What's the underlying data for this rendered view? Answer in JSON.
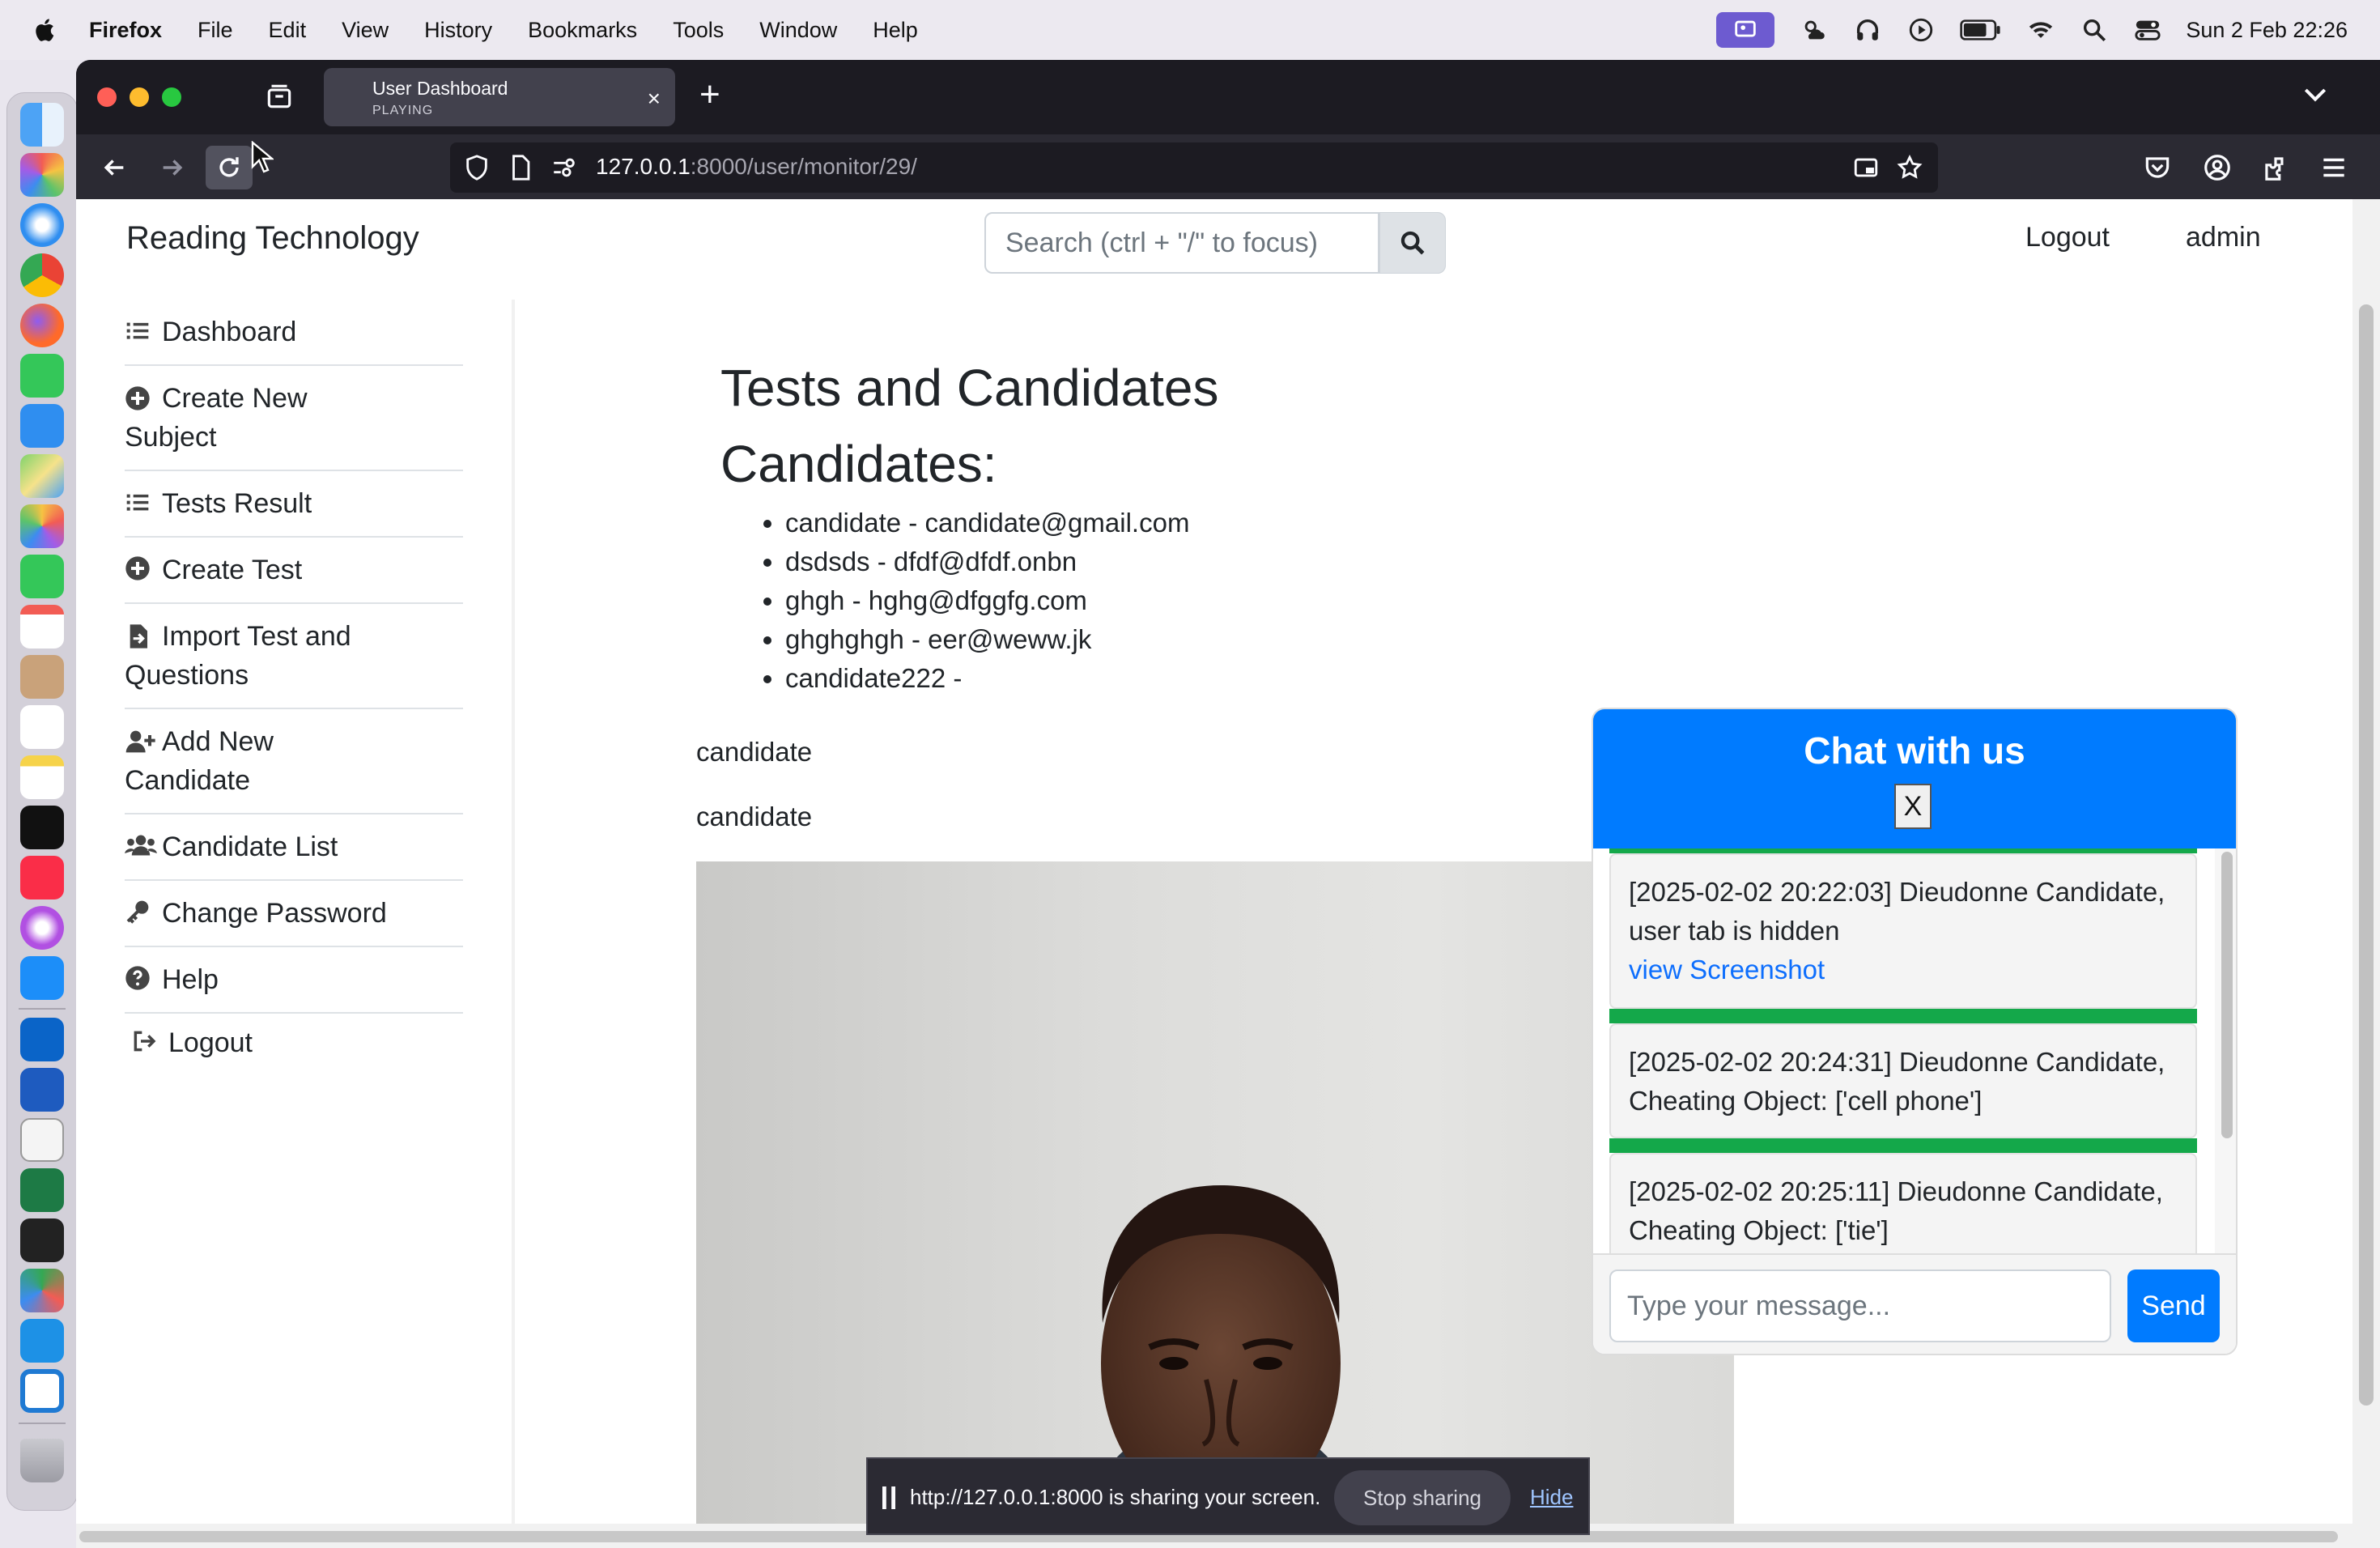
{
  "menubar": {
    "app_name": "Firefox",
    "items": [
      "File",
      "Edit",
      "View",
      "History",
      "Bookmarks",
      "Tools",
      "Window",
      "Help"
    ],
    "clock": "Sun 2 Feb  22:26"
  },
  "browser": {
    "tab": {
      "title": "User Dashboard",
      "subtitle": "PLAYING"
    },
    "url_host": "127.0.0.1",
    "url_rest": ":8000/user/monitor/29/"
  },
  "page": {
    "brand": "Reading Technology",
    "search_placeholder": "Search (ctrl + \"/\" to focus)",
    "top_logout": "Logout",
    "top_user": "admin",
    "sidebar": {
      "dashboard": "Dashboard",
      "create_subject_1": "Create New",
      "create_subject_2": "Subject",
      "tests_result": "Tests Result",
      "create_test": "Create Test",
      "import_1": "Import Test and",
      "import_2": "Questions",
      "add_candidate_1": "Add New",
      "add_candidate_2": "Candidate",
      "candidate_list": "Candidate List",
      "change_password": "Change Password",
      "help": "Help",
      "logout": "Logout"
    },
    "heading": "Tests and Candidates",
    "subheading": "Candidates:",
    "candidates": [
      "candidate - candidate@gmail.com",
      "dsdsds - dfdf@dfdf.onbn",
      "ghgh - hghg@dfggfg.com",
      "ghghghgh - eer@weww.jk",
      "candidate222 -"
    ],
    "text_line_1": "candidate",
    "text_line_2": "candidate"
  },
  "chat": {
    "title": "Chat with us",
    "close_label": "X",
    "messages": [
      {
        "text": "[2025-02-02 20:22:03] Dieudonne Candidate, user tab is hidden",
        "link": "view Screenshot"
      },
      {
        "text": "[2025-02-02 20:24:31] Dieudonne Candidate, Cheating Object: ['cell phone']"
      },
      {
        "text": "[2025-02-02 20:25:11] Dieudonne Candidate, Cheating Object: ['tie']"
      }
    ],
    "input_placeholder": "Type your message...",
    "send_label": "Send"
  },
  "sharing": {
    "text": "http://127.0.0.1:8000 is sharing your screen.",
    "stop_label": "Stop sharing",
    "hide_label": "Hide"
  },
  "colors": {
    "primary": "#007bff",
    "alert_bar": "#14a84a",
    "firefox_dark": "#1c1b22"
  }
}
